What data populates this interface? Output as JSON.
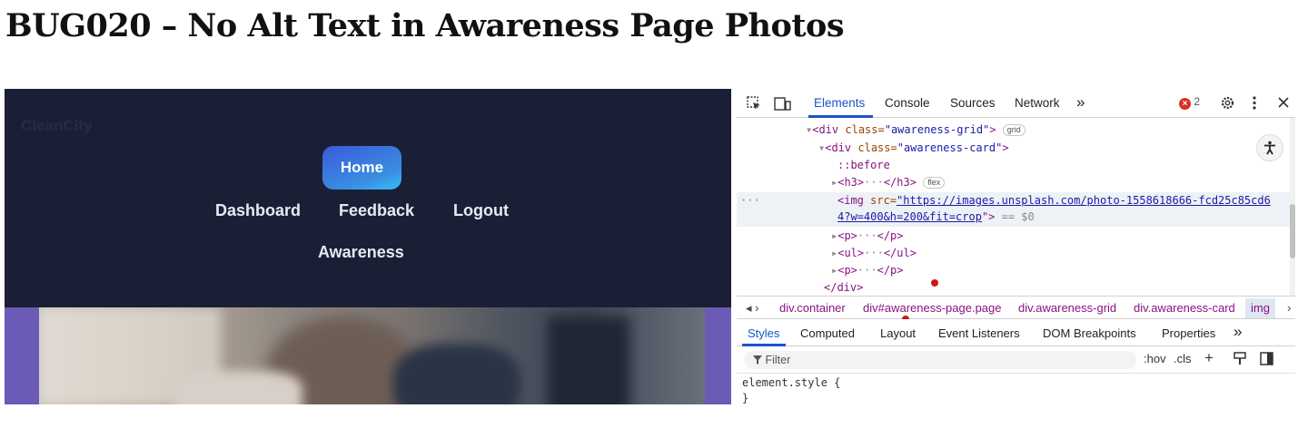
{
  "document": {
    "title": "BUG020 – No Alt Text in Awareness Page Photos"
  },
  "app": {
    "brand": "CleanCity",
    "nav": {
      "home": "Home",
      "dashboard": "Dashboard",
      "feedback": "Feedback",
      "logout": "Logout",
      "awareness": "Awareness"
    },
    "colors": {
      "navbar": "#1a1f36",
      "accent": "#3b5bdb",
      "side": "#6b5bb7"
    }
  },
  "devtools": {
    "tabs": [
      "Elements",
      "Console",
      "Sources",
      "Network"
    ],
    "more_tabs": "»",
    "error_count": "2",
    "icons": [
      "inspect-icon",
      "device-toolbar-icon",
      "settings-icon",
      "more-vertical-icon",
      "close-icon",
      "accessibility-icon"
    ],
    "elements": {
      "line1_tag": "<div",
      "line1_attr": " class=",
      "line1_val": "\"awareness-grid\"",
      "line1_end": ">",
      "line1_pill": "grid",
      "line2_tag": "<div",
      "line2_attr": " class=",
      "line2_val": "\"awareness-card\"",
      "line2_end": ">",
      "line3": "::before",
      "line4_open": "<h3>",
      "line4_dots": "···",
      "line4_close": "</h3>",
      "line4_pill": "flex",
      "line5_tag": "<img",
      "line5_attr": " src=",
      "line5_url_a": "\"https://images.unsplash.com/photo-1558618666-fcd25c85cd6",
      "line5_url_b": "4?w=400&h=200&fit=crop",
      "line5_end": "\">",
      "line5_eq": " == $0",
      "gutter": "···",
      "line6_open": "<p>",
      "line6_dots": "···",
      "line6_close": "</p>",
      "line7_open": "<ul>",
      "line7_dots": "···",
      "line7_close": "</ul>",
      "line8_open": "<p>",
      "line8_dots": "···",
      "line8_close": "</p>",
      "line9": "</div>"
    },
    "breadcrumbs": [
      "div.container",
      "div#awareness-page.page",
      "div.awareness-grid",
      "div.awareness-card",
      "img"
    ],
    "subtabs": [
      "Styles",
      "Computed",
      "Layout",
      "Event Listeners",
      "DOM Breakpoints",
      "Properties"
    ],
    "filter": {
      "placeholder": "Filter",
      "hov": ":hov",
      "cls": ".cls"
    },
    "styles": {
      "line1": "element.style {",
      "line2": "}"
    }
  }
}
